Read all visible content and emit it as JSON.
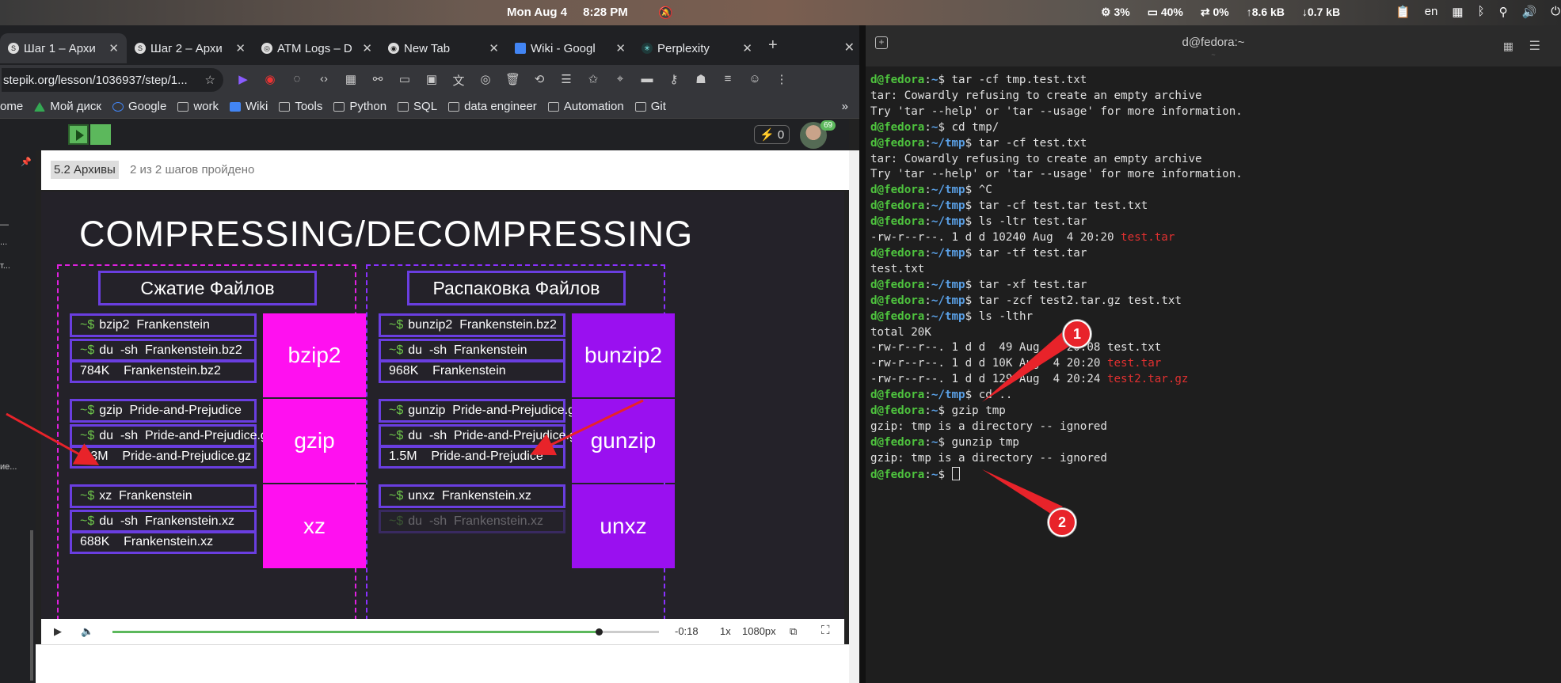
{
  "topbar": {
    "date": "Mon Aug 4",
    "time": "8:28 PM",
    "cpu": "3%",
    "memory": "40%",
    "swap": "0%",
    "upload": "8.6 kB",
    "download": "0.7 kB",
    "layout": "en"
  },
  "browser": {
    "tabs": [
      {
        "title": "Шаг 1 – Архи",
        "icon": "stepik-icon"
      },
      {
        "title": "Шаг 2 – Архи",
        "icon": "stepik-icon"
      },
      {
        "title": "ATM Logs – D",
        "icon": "globe-icon"
      },
      {
        "title": "New Tab",
        "icon": "chrome-icon"
      },
      {
        "title": "Wiki - Googl",
        "icon": "docs-icon"
      },
      {
        "title": "Perplexity",
        "icon": "perplexity-icon"
      }
    ],
    "url": "stepik.org/lesson/1036937/step/1...",
    "bookmarks": [
      "ome",
      "Мой диск",
      "Google",
      "work",
      "Wiki",
      "Tools",
      "Python",
      "SQL",
      "data engineer",
      "Automation",
      "Git"
    ],
    "more": "»"
  },
  "lesson": {
    "energy": "0",
    "avatar_badge": "69",
    "section": "5.2 Архивы",
    "progress": "2 из 2 шагов пройдено",
    "left_labels": [
      "...",
      "т...",
      "ие..."
    ]
  },
  "slide": {
    "title": "COMPRESSING/DECOMPRESSING",
    "left_header": "Сжатие Файлов",
    "right_header": "Распаковка Файлов",
    "prompt": "~$",
    "left_groups": [
      {
        "cmd": "bzip2  Frankenstein",
        "du": "du  -sh  Frankenstein.bz2",
        "out": "784K    Frankenstein.bz2",
        "label": "bzip2"
      },
      {
        "cmd": "gzip  Pride-and-Prejudice",
        "du": "du  -sh  Pride-and-Prejudice.gz",
        "out": "1.3M    Pride-and-Prejudice.gz",
        "label": "gzip"
      },
      {
        "cmd": "xz  Frankenstein",
        "du": "du  -sh  Frankenstein.xz",
        "out": "688K    Frankenstein.xz",
        "label": "xz"
      }
    ],
    "right_groups": [
      {
        "cmd": "bunzip2  Frankenstein.bz2",
        "du": "du  -sh  Frankenstein",
        "out": "968K    Frankenstein",
        "label": "bunzip2"
      },
      {
        "cmd": "gunzip  Pride-and-Prejudice.gz",
        "du": "du  -sh  Pride-and-Prejudice.gz",
        "out": "1.5M    Pride-and-Prejudice",
        "label": "gunzip"
      },
      {
        "cmd": "unxz  Frankenstein.xz",
        "du": "du  -sh  Frankenstein.xz",
        "out": "",
        "label": "unxz"
      }
    ]
  },
  "player": {
    "time_left": "-0:18",
    "speed": "1x",
    "quality": "1080px",
    "progress": 0.89
  },
  "terminal": {
    "title": "d@fedora:~",
    "lines": [
      [
        {
          "c": "u",
          "t": "d@fedora"
        },
        {
          "c": "",
          "t": ":"
        },
        {
          "c": "p",
          "t": "~"
        },
        {
          "c": "",
          "t": "$ tar -cf tmp.test.txt"
        }
      ],
      [
        {
          "c": "",
          "t": "tar: Cowardly refusing to create an empty archive"
        }
      ],
      [
        {
          "c": "",
          "t": "Try 'tar --help' or 'tar --usage' for more information."
        }
      ],
      [
        {
          "c": "u",
          "t": "d@fedora"
        },
        {
          "c": "",
          "t": ":"
        },
        {
          "c": "p",
          "t": "~"
        },
        {
          "c": "",
          "t": "$ cd tmp/"
        }
      ],
      [
        {
          "c": "u",
          "t": "d@fedora"
        },
        {
          "c": "",
          "t": ":"
        },
        {
          "c": "p",
          "t": "~/tmp"
        },
        {
          "c": "",
          "t": "$ tar -cf test.txt"
        }
      ],
      [
        {
          "c": "",
          "t": "tar: Cowardly refusing to create an empty archive"
        }
      ],
      [
        {
          "c": "",
          "t": "Try 'tar --help' or 'tar --usage' for more information."
        }
      ],
      [
        {
          "c": "u",
          "t": "d@fedora"
        },
        {
          "c": "",
          "t": ":"
        },
        {
          "c": "p",
          "t": "~/tmp"
        },
        {
          "c": "",
          "t": "$ ^C"
        }
      ],
      [
        {
          "c": "u",
          "t": "d@fedora"
        },
        {
          "c": "",
          "t": ":"
        },
        {
          "c": "p",
          "t": "~/tmp"
        },
        {
          "c": "",
          "t": "$ tar -cf test.tar test.txt"
        }
      ],
      [
        {
          "c": "u",
          "t": "d@fedora"
        },
        {
          "c": "",
          "t": ":"
        },
        {
          "c": "p",
          "t": "~/tmp"
        },
        {
          "c": "",
          "t": "$ ls -ltr test.tar"
        }
      ],
      [
        {
          "c": "",
          "t": "-rw-r--r--. 1 d d 10240 Aug  4 20:20 "
        },
        {
          "c": "red",
          "t": "test.tar"
        }
      ],
      [
        {
          "c": "u",
          "t": "d@fedora"
        },
        {
          "c": "",
          "t": ":"
        },
        {
          "c": "p",
          "t": "~/tmp"
        },
        {
          "c": "",
          "t": "$ tar -tf test.tar"
        }
      ],
      [
        {
          "c": "",
          "t": "test.txt"
        }
      ],
      [
        {
          "c": "u",
          "t": "d@fedora"
        },
        {
          "c": "",
          "t": ":"
        },
        {
          "c": "p",
          "t": "~/tmp"
        },
        {
          "c": "",
          "t": "$ tar -xf test.tar"
        }
      ],
      [
        {
          "c": "u",
          "t": "d@fedora"
        },
        {
          "c": "",
          "t": ":"
        },
        {
          "c": "p",
          "t": "~/tmp"
        },
        {
          "c": "",
          "t": "$ tar -zcf test2.tar.gz test.txt"
        }
      ],
      [
        {
          "c": "u",
          "t": "d@fedora"
        },
        {
          "c": "",
          "t": ":"
        },
        {
          "c": "p",
          "t": "~/tmp"
        },
        {
          "c": "",
          "t": "$ ls -lthr"
        }
      ],
      [
        {
          "c": "",
          "t": "total 20K"
        }
      ],
      [
        {
          "c": "",
          "t": "-rw-r--r--. 1 d d  49 Aug  4 20:08 test.txt"
        }
      ],
      [
        {
          "c": "",
          "t": "-rw-r--r--. 1 d d 10K Aug  4 20:20 "
        },
        {
          "c": "red",
          "t": "test.tar"
        }
      ],
      [
        {
          "c": "",
          "t": "-rw-r--r--. 1 d d 129 Aug  4 20:24 "
        },
        {
          "c": "red",
          "t": "test2.tar.gz"
        }
      ],
      [
        {
          "c": "u",
          "t": "d@fedora"
        },
        {
          "c": "",
          "t": ":"
        },
        {
          "c": "p",
          "t": "~/tmp"
        },
        {
          "c": "",
          "t": "$ cd .."
        }
      ],
      [
        {
          "c": "u",
          "t": "d@fedora"
        },
        {
          "c": "",
          "t": ":"
        },
        {
          "c": "p",
          "t": "~"
        },
        {
          "c": "",
          "t": "$ gzip tmp"
        }
      ],
      [
        {
          "c": "",
          "t": "gzip: tmp is a directory -- ignored"
        }
      ],
      [
        {
          "c": "u",
          "t": "d@fedora"
        },
        {
          "c": "",
          "t": ":"
        },
        {
          "c": "p",
          "t": "~"
        },
        {
          "c": "",
          "t": "$ gunzip tmp"
        }
      ],
      [
        {
          "c": "",
          "t": "gzip: tmp is a directory -- ignored"
        }
      ],
      [
        {
          "c": "u",
          "t": "d@fedora"
        },
        {
          "c": "",
          "t": ":"
        },
        {
          "c": "p",
          "t": "~"
        },
        {
          "c": "",
          "t": "$ "
        }
      ]
    ]
  },
  "annotations": {
    "callout_1": "1",
    "callout_2": "2",
    "arrow_color": "#e8232a"
  },
  "colors": {
    "magenta": "#ff10f0",
    "purple": "#9a10f0",
    "prompt_green": "#4ec33e",
    "path_blue": "#5aa0e6",
    "archive_red": "#e03030"
  }
}
